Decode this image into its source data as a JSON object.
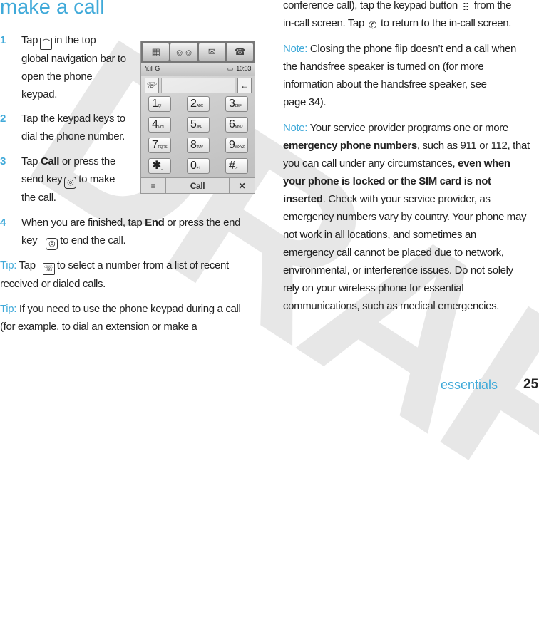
{
  "watermark": "DRAFT",
  "title": "make a call",
  "steps": [
    {
      "num": "1",
      "pre": "Tap",
      "icon": "phone-icon",
      "post": "in the top",
      "lines": [
        "global navigation bar to",
        "open the phone",
        "keypad."
      ]
    },
    {
      "num": "2",
      "lines": [
        "Tap the keypad keys to",
        "dial the phone number."
      ]
    },
    {
      "num": "3",
      "l1a": "Tap ",
      "l1b": "Call",
      "l1c": " or press the",
      "l2a": "send key",
      "l2b": "to make",
      "l3": "the call."
    },
    {
      "num": "4",
      "l1a": "When you are finished, tap ",
      "l1b": "End",
      "l1c": " or press the end",
      "l2a": "key",
      "l2b": "to end the call."
    }
  ],
  "tip1": {
    "label": "Tip:",
    "a": " Tap",
    "b": "to select a number from a list of recent",
    "c": "received or dialed calls."
  },
  "tip2": {
    "label": "Tip:",
    "a": " If you need to use the phone keypad during a call",
    "b": "(for example, to dial an extension or make a"
  },
  "right": {
    "p1a": "conference call), tap the keypad button",
    "p1b": "from the",
    "p1c": "in-call screen. Tap",
    "p1d": "to return to the in-call screen.",
    "note1": {
      "label": "Note:",
      "lines": [
        " Closing the phone flip doesn’t end a call when",
        "the handsfree speaker is turned on (for more",
        "information about the handsfree speaker, see",
        "page 34)."
      ]
    },
    "note2": {
      "label": "Note:",
      "l1": " Your service provider programs one or more",
      "l2a": "emergency phone numbers",
      "l2b": ", such as 911 or 112, that",
      "l3a": "you can call under any circumstances, ",
      "l3b": "even when",
      "l4": "your phone is locked or the SIM card is not",
      "l5a": "inserted",
      "l5b": ". Check with your service provider, as",
      "rest": [
        "emergency numbers vary by country. Your phone may",
        "not work in all locations, and sometimes an",
        "emergency call cannot be placed due to network,",
        "environmental, or interference issues. Do not solely",
        "rely on your wireless phone for essential",
        "communications, such as medical emergencies."
      ]
    }
  },
  "phone": {
    "nav": [
      "▦",
      "☺☺",
      "✉",
      "☎"
    ],
    "signal": "Y.ıll G",
    "battery": "▭",
    "time": "10:03",
    "keys": [
      [
        "1",
        "Q!"
      ],
      [
        "2",
        "ABC"
      ],
      [
        "3",
        "DEF"
      ],
      [
        "4",
        "GHI"
      ],
      [
        "5",
        "JKL"
      ],
      [
        "6",
        "MNO"
      ],
      [
        "7",
        "PQRS"
      ],
      [
        "8",
        "TUV"
      ],
      [
        "9",
        "WXYZ"
      ],
      [
        "✱",
        "_"
      ],
      [
        "0",
        "+⇧"
      ],
      [
        "#",
        "↗"
      ]
    ],
    "menu": "≡",
    "call": "Call",
    "close": "✕",
    "back": "←",
    "recent": "☏"
  },
  "footer": {
    "section": "essentials",
    "page": "25"
  },
  "colors": {
    "accent": "#3fa9d9"
  }
}
